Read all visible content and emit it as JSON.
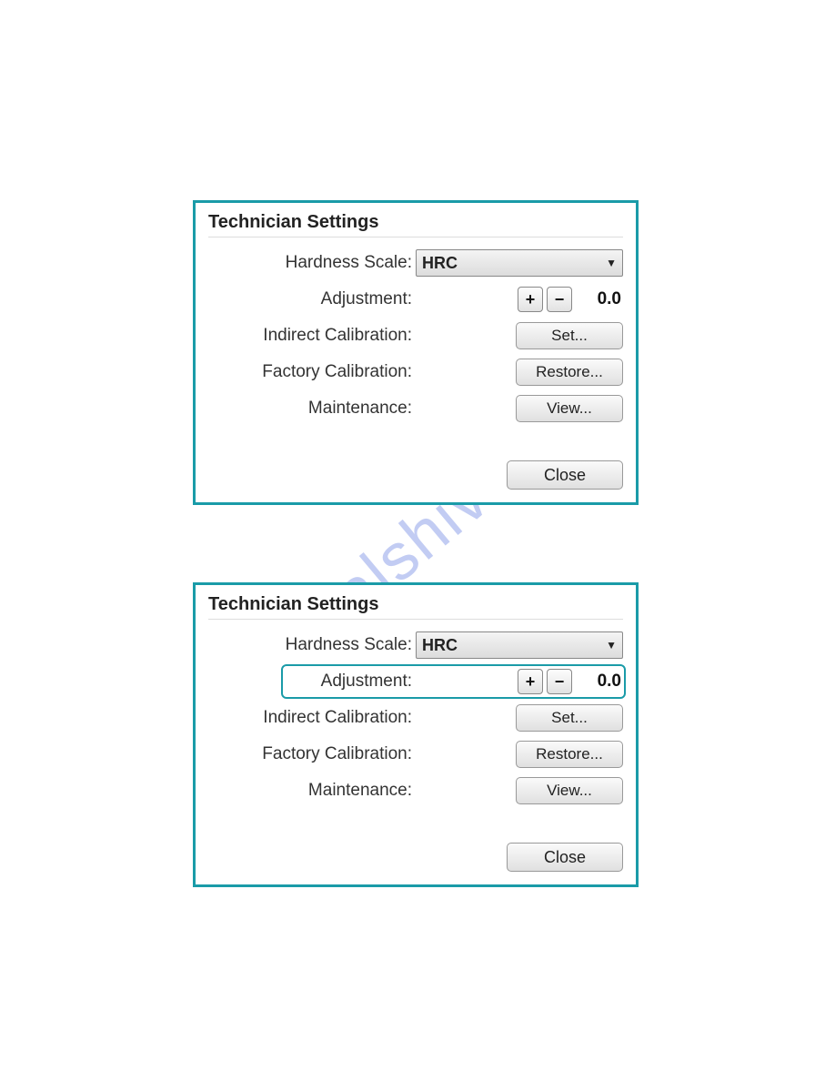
{
  "watermark_text": "manualshive.com",
  "panel1": {
    "title": "Technician Settings",
    "hardness_label": "Hardness Scale:",
    "hardness_value": "HRC",
    "adjustment_label": "Adjustment:",
    "adjustment_plus": "+",
    "adjustment_minus": "−",
    "adjustment_value": "0.0",
    "indirect_label": "Indirect Calibration:",
    "indirect_button": "Set...",
    "factory_label": "Factory Calibration:",
    "factory_button": "Restore...",
    "maintenance_label": "Maintenance:",
    "maintenance_button": "View...",
    "close_button": "Close"
  },
  "panel2": {
    "title": "Technician Settings",
    "hardness_label": "Hardness Scale:",
    "hardness_value": "HRC",
    "adjustment_label": "Adjustment:",
    "adjustment_plus": "+",
    "adjustment_minus": "−",
    "adjustment_value": "0.0",
    "indirect_label": "Indirect Calibration:",
    "indirect_button": "Set...",
    "factory_label": "Factory Calibration:",
    "factory_button": "Restore...",
    "maintenance_label": "Maintenance:",
    "maintenance_button": "View...",
    "close_button": "Close"
  }
}
